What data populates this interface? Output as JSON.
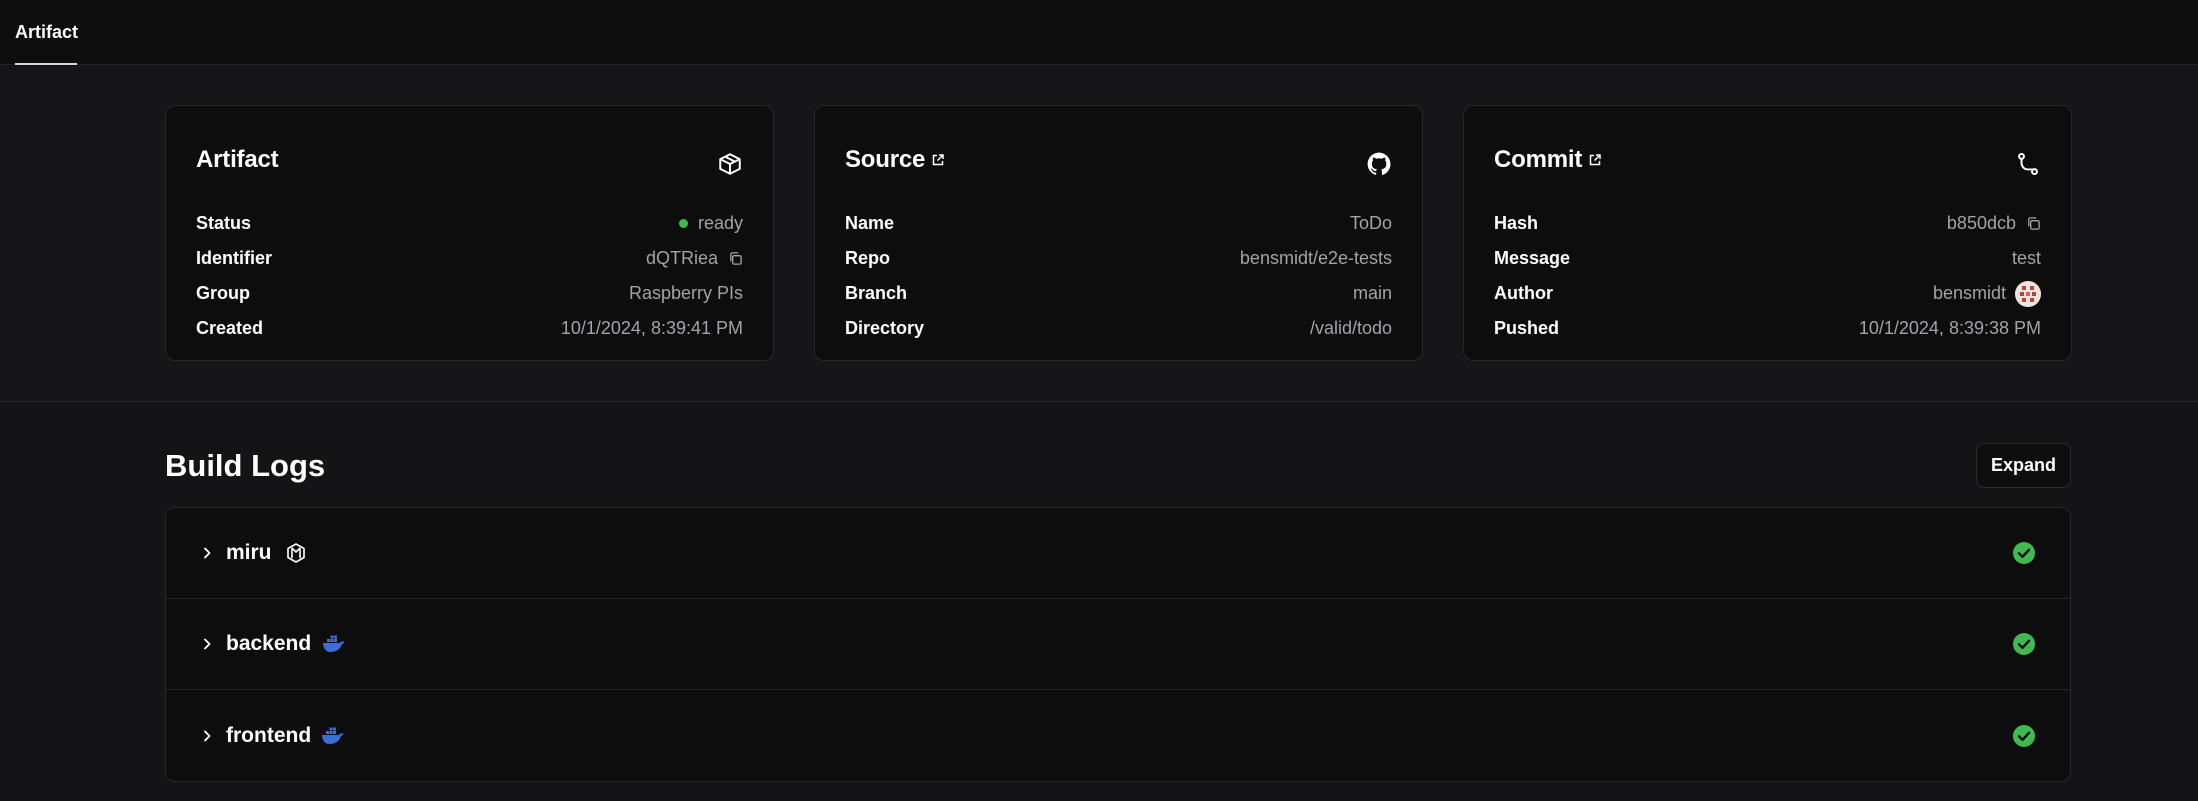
{
  "topbar": {
    "tab_label": "Artifact"
  },
  "cards": {
    "artifact": {
      "title": "Artifact",
      "icon": "box-icon",
      "rows": [
        {
          "label": "Status",
          "value": "ready"
        },
        {
          "label": "Identifier",
          "value": "dQTRiea"
        },
        {
          "label": "Group",
          "value": "Raspberry PIs"
        },
        {
          "label": "Created",
          "value": "10/1/2024, 8:39:41 PM"
        }
      ]
    },
    "source": {
      "title": "Source",
      "icon": "github-icon",
      "rows": [
        {
          "label": "Name",
          "value": "ToDo"
        },
        {
          "label": "Repo",
          "value": "bensmidt/e2e-tests"
        },
        {
          "label": "Branch",
          "value": "main"
        },
        {
          "label": "Directory",
          "value": "/valid/todo"
        }
      ]
    },
    "commit": {
      "title": "Commit",
      "icon": "git-commit-icon",
      "rows": [
        {
          "label": "Hash",
          "value": "b850dcb"
        },
        {
          "label": "Message",
          "value": "test"
        },
        {
          "label": "Author",
          "value": "bensmidt"
        },
        {
          "label": "Pushed",
          "value": "10/1/2024, 8:39:38 PM"
        }
      ]
    }
  },
  "build_logs": {
    "title": "Build Logs",
    "expand_label": "Expand",
    "items": [
      {
        "name": "miru",
        "icon": "miru-logo-icon",
        "status": "success"
      },
      {
        "name": "backend",
        "icon": "docker-icon",
        "status": "success"
      },
      {
        "name": "frontend",
        "icon": "docker-icon",
        "status": "success"
      }
    ]
  },
  "colors": {
    "background": "#141416",
    "card": "#0d0d0e",
    "status_ready": "#3fb950",
    "success": "#3fb950",
    "docker": "#3b6fd8"
  }
}
